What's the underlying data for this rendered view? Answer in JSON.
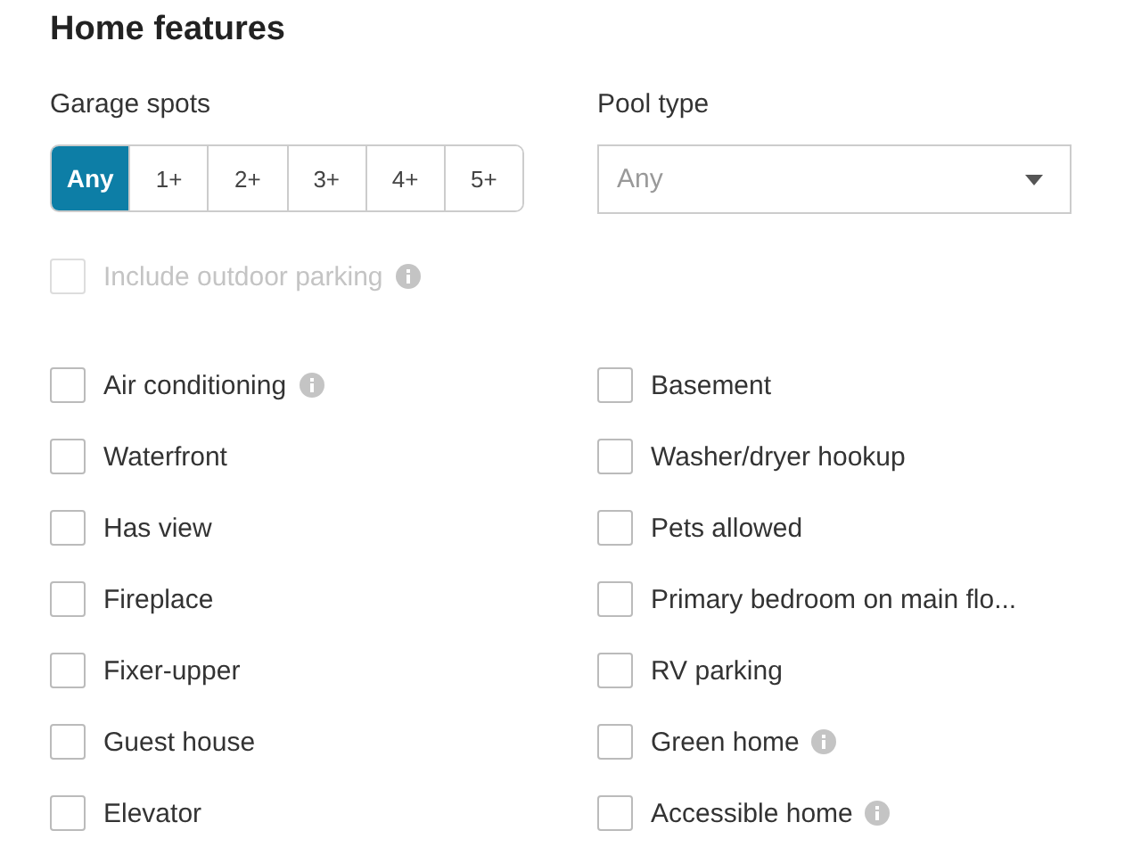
{
  "title": "Home features",
  "garage": {
    "label": "Garage spots",
    "options": [
      {
        "label": "Any",
        "selected": true
      },
      {
        "label": "1+",
        "selected": false
      },
      {
        "label": "2+",
        "selected": false
      },
      {
        "label": "3+",
        "selected": false
      },
      {
        "label": "4+",
        "selected": false
      },
      {
        "label": "5+",
        "selected": false
      }
    ]
  },
  "pool": {
    "label": "Pool type",
    "placeholder": "Any"
  },
  "outdoor_parking": {
    "label": "Include outdoor parking",
    "checked": false,
    "disabled": true,
    "info": true
  },
  "features": [
    {
      "label": "Air conditioning",
      "checked": false,
      "info": true
    },
    {
      "label": "Basement",
      "checked": false,
      "info": false
    },
    {
      "label": "Waterfront",
      "checked": false,
      "info": false
    },
    {
      "label": "Washer/dryer hookup",
      "checked": false,
      "info": false
    },
    {
      "label": "Has view",
      "checked": false,
      "info": false
    },
    {
      "label": "Pets allowed",
      "checked": false,
      "info": false
    },
    {
      "label": "Fireplace",
      "checked": false,
      "info": false
    },
    {
      "label": "Primary bedroom on main flo...",
      "checked": false,
      "info": false
    },
    {
      "label": "Fixer-upper",
      "checked": false,
      "info": false
    },
    {
      "label": "RV parking",
      "checked": false,
      "info": false
    },
    {
      "label": "Guest house",
      "checked": false,
      "info": false
    },
    {
      "label": "Green home",
      "checked": false,
      "info": true
    },
    {
      "label": "Elevator",
      "checked": false,
      "info": false
    },
    {
      "label": "Accessible home",
      "checked": false,
      "info": true
    }
  ]
}
